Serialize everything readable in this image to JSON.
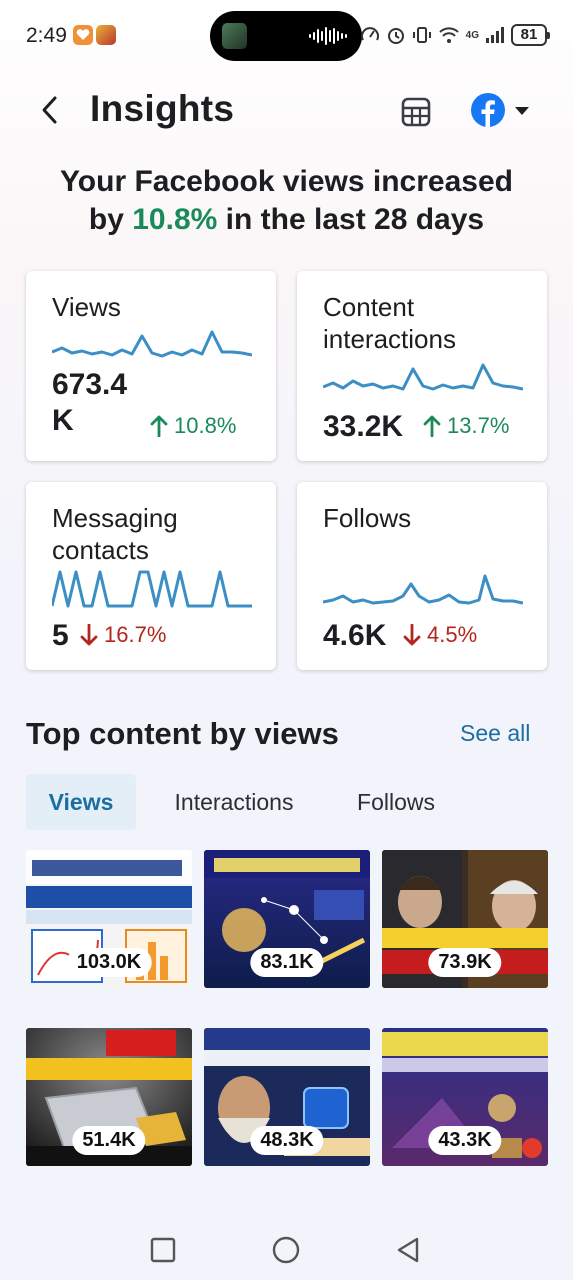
{
  "status_bar": {
    "time": "2:49",
    "battery": "81",
    "network": "4G"
  },
  "header": {
    "title": "Insights",
    "back_icon": "chevron-left-icon",
    "table_icon": "table-icon",
    "account_icon": "facebook-icon",
    "dropdown_icon": "caret-down-icon"
  },
  "headline": {
    "before": "Your Facebook views increased",
    "by": "by",
    "percent": "10.8%",
    "after": "in the last 28 days"
  },
  "cards": [
    {
      "title": "Views",
      "value": "673.4 K",
      "value_line1": "673.4",
      "value_line2": "K",
      "change": "10.8%",
      "direction": "up"
    },
    {
      "title_line1": "Content",
      "title_line2": "interactions",
      "value": "33.2K",
      "change": "13.7%",
      "direction": "up"
    },
    {
      "title_line1": "Messaging",
      "title_line2": "contacts",
      "value": "5",
      "change": "16.7%",
      "direction": "down"
    },
    {
      "title": "Follows",
      "value": "4.6K",
      "change": "4.5%",
      "direction": "down"
    }
  ],
  "top_content": {
    "title": "Top content by views",
    "see_all": "See all",
    "tabs": [
      "Views",
      "Interactions",
      "Follows"
    ],
    "active_tab": "Views",
    "items": [
      {
        "views": "103.0K"
      },
      {
        "views": "83.1K"
      },
      {
        "views": "73.9K"
      },
      {
        "views": "51.4K"
      },
      {
        "views": "48.3K"
      },
      {
        "views": "43.3K"
      }
    ]
  },
  "colors": {
    "up": "#1a8a5a",
    "down": "#b3261e",
    "link": "#1b6e9f",
    "spark": "#3b8fc4",
    "facebook": "#1877f2"
  }
}
